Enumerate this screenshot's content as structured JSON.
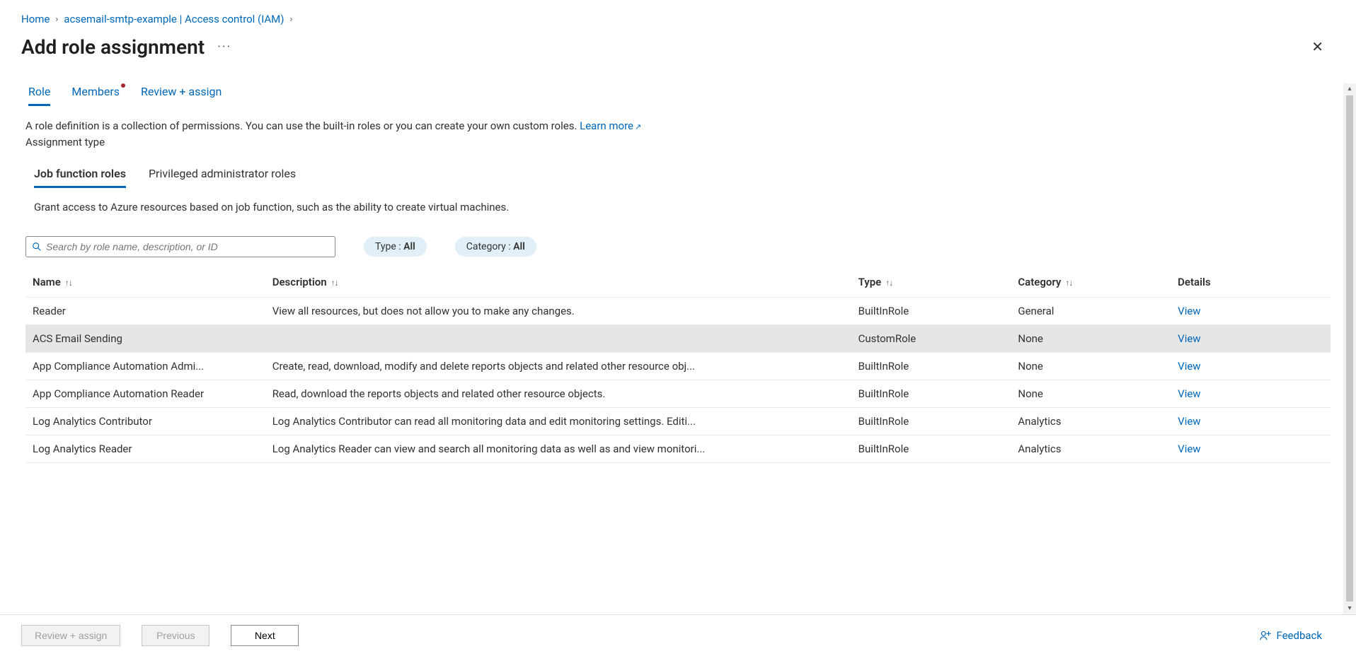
{
  "breadcrumb": {
    "home": "Home",
    "iam": "acsemail-smtp-example | Access control (IAM)"
  },
  "title": "Add role assignment",
  "tabs": {
    "role": "Role",
    "members": "Members",
    "review": "Review + assign"
  },
  "help": {
    "line1": "A role definition is a collection of permissions. You can use the built-in roles or you can create your own custom roles. ",
    "learn_more": "Learn more",
    "assignment_type_label": "Assignment type"
  },
  "subtabs": {
    "job": "Job function roles",
    "priv": "Privileged administrator roles"
  },
  "subhelp": "Grant access to Azure resources based on job function, such as the ability to create virtual machines.",
  "search": {
    "placeholder": "Search by role name, description, or ID"
  },
  "filters": {
    "type_label": "Type : ",
    "type_value": "All",
    "category_label": "Category : ",
    "category_value": "All"
  },
  "columns": {
    "name": "Name",
    "description": "Description",
    "type": "Type",
    "category": "Category",
    "details": "Details"
  },
  "view_label": "View",
  "rows": [
    {
      "name": "Reader",
      "description": "View all resources, but does not allow you to make any changes.",
      "type": "BuiltInRole",
      "category": "General",
      "selected": false
    },
    {
      "name": "ACS Email Sending",
      "description": "",
      "type": "CustomRole",
      "category": "None",
      "selected": true
    },
    {
      "name": "App Compliance Automation Admi...",
      "description": "Create, read, download, modify and delete reports objects and related other resource obj...",
      "type": "BuiltInRole",
      "category": "None",
      "selected": false
    },
    {
      "name": "App Compliance Automation Reader",
      "description": "Read, download the reports objects and related other resource objects.",
      "type": "BuiltInRole",
      "category": "None",
      "selected": false
    },
    {
      "name": "Log Analytics Contributor",
      "description": "Log Analytics Contributor can read all monitoring data and edit monitoring settings. Editi...",
      "type": "BuiltInRole",
      "category": "Analytics",
      "selected": false
    },
    {
      "name": "Log Analytics Reader",
      "description": "Log Analytics Reader can view and search all monitoring data as well as and view monitori...",
      "type": "BuiltInRole",
      "category": "Analytics",
      "selected": false
    }
  ],
  "footer": {
    "review": "Review + assign",
    "previous": "Previous",
    "next": "Next",
    "feedback": "Feedback"
  }
}
